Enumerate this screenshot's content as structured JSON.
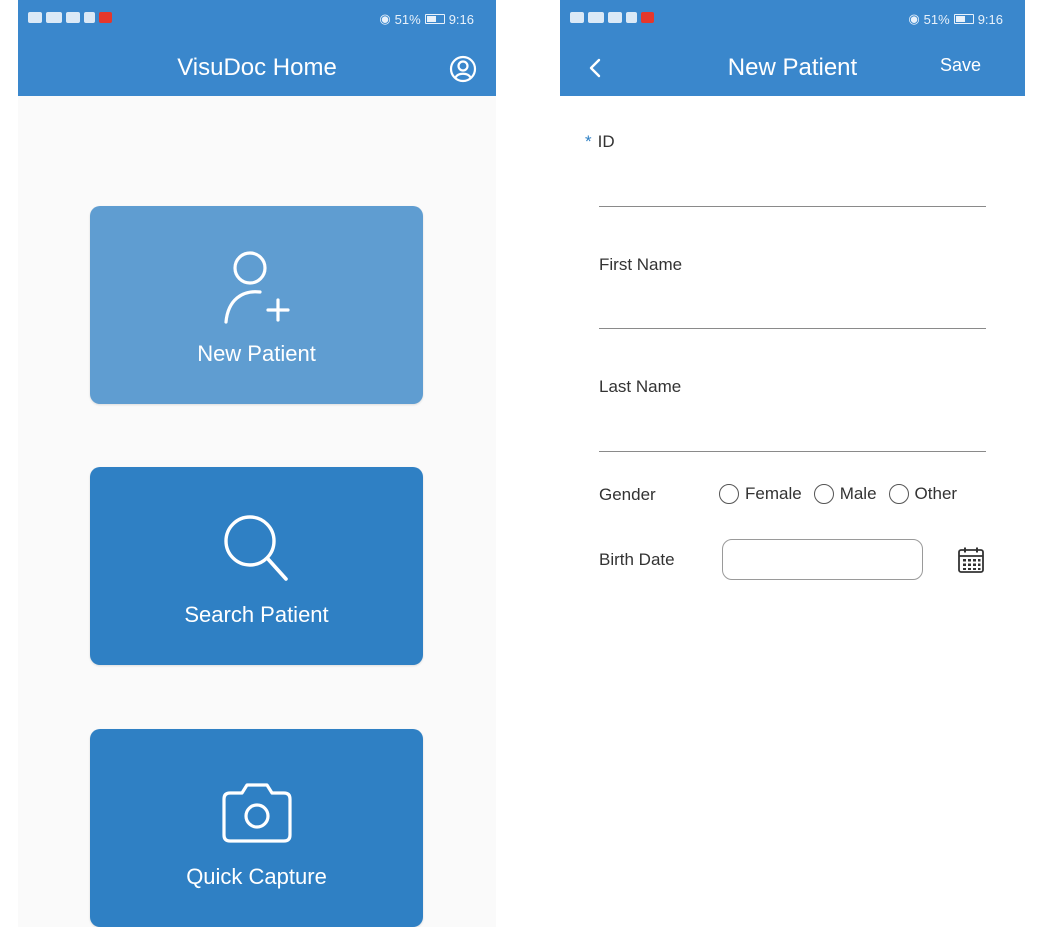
{
  "left": {
    "status": {
      "battery": "51%",
      "time": "9:16"
    },
    "title": "VisuDoc Home",
    "tiles": [
      {
        "label": "New Patient",
        "icon": "add-user-icon"
      },
      {
        "label": "Search Patient",
        "icon": "search-icon"
      },
      {
        "label": "Quick Capture",
        "icon": "camera-icon"
      }
    ]
  },
  "right": {
    "status": {
      "battery": "51%",
      "time": "9:16"
    },
    "title": "New Patient",
    "save_label": "Save",
    "required_marker": "*",
    "fields": {
      "id_label": "ID",
      "first_name_label": "First Name",
      "last_name_label": "Last Name"
    },
    "gender": {
      "label": "Gender",
      "options": [
        "Female",
        "Male",
        "Other"
      ]
    },
    "birth_date_label": "Birth Date"
  },
  "colors": {
    "appbar": "#3a87cc",
    "tile": "#2f80c4",
    "tile_light": "#5f9dd1",
    "accent": "#2f80c4"
  }
}
